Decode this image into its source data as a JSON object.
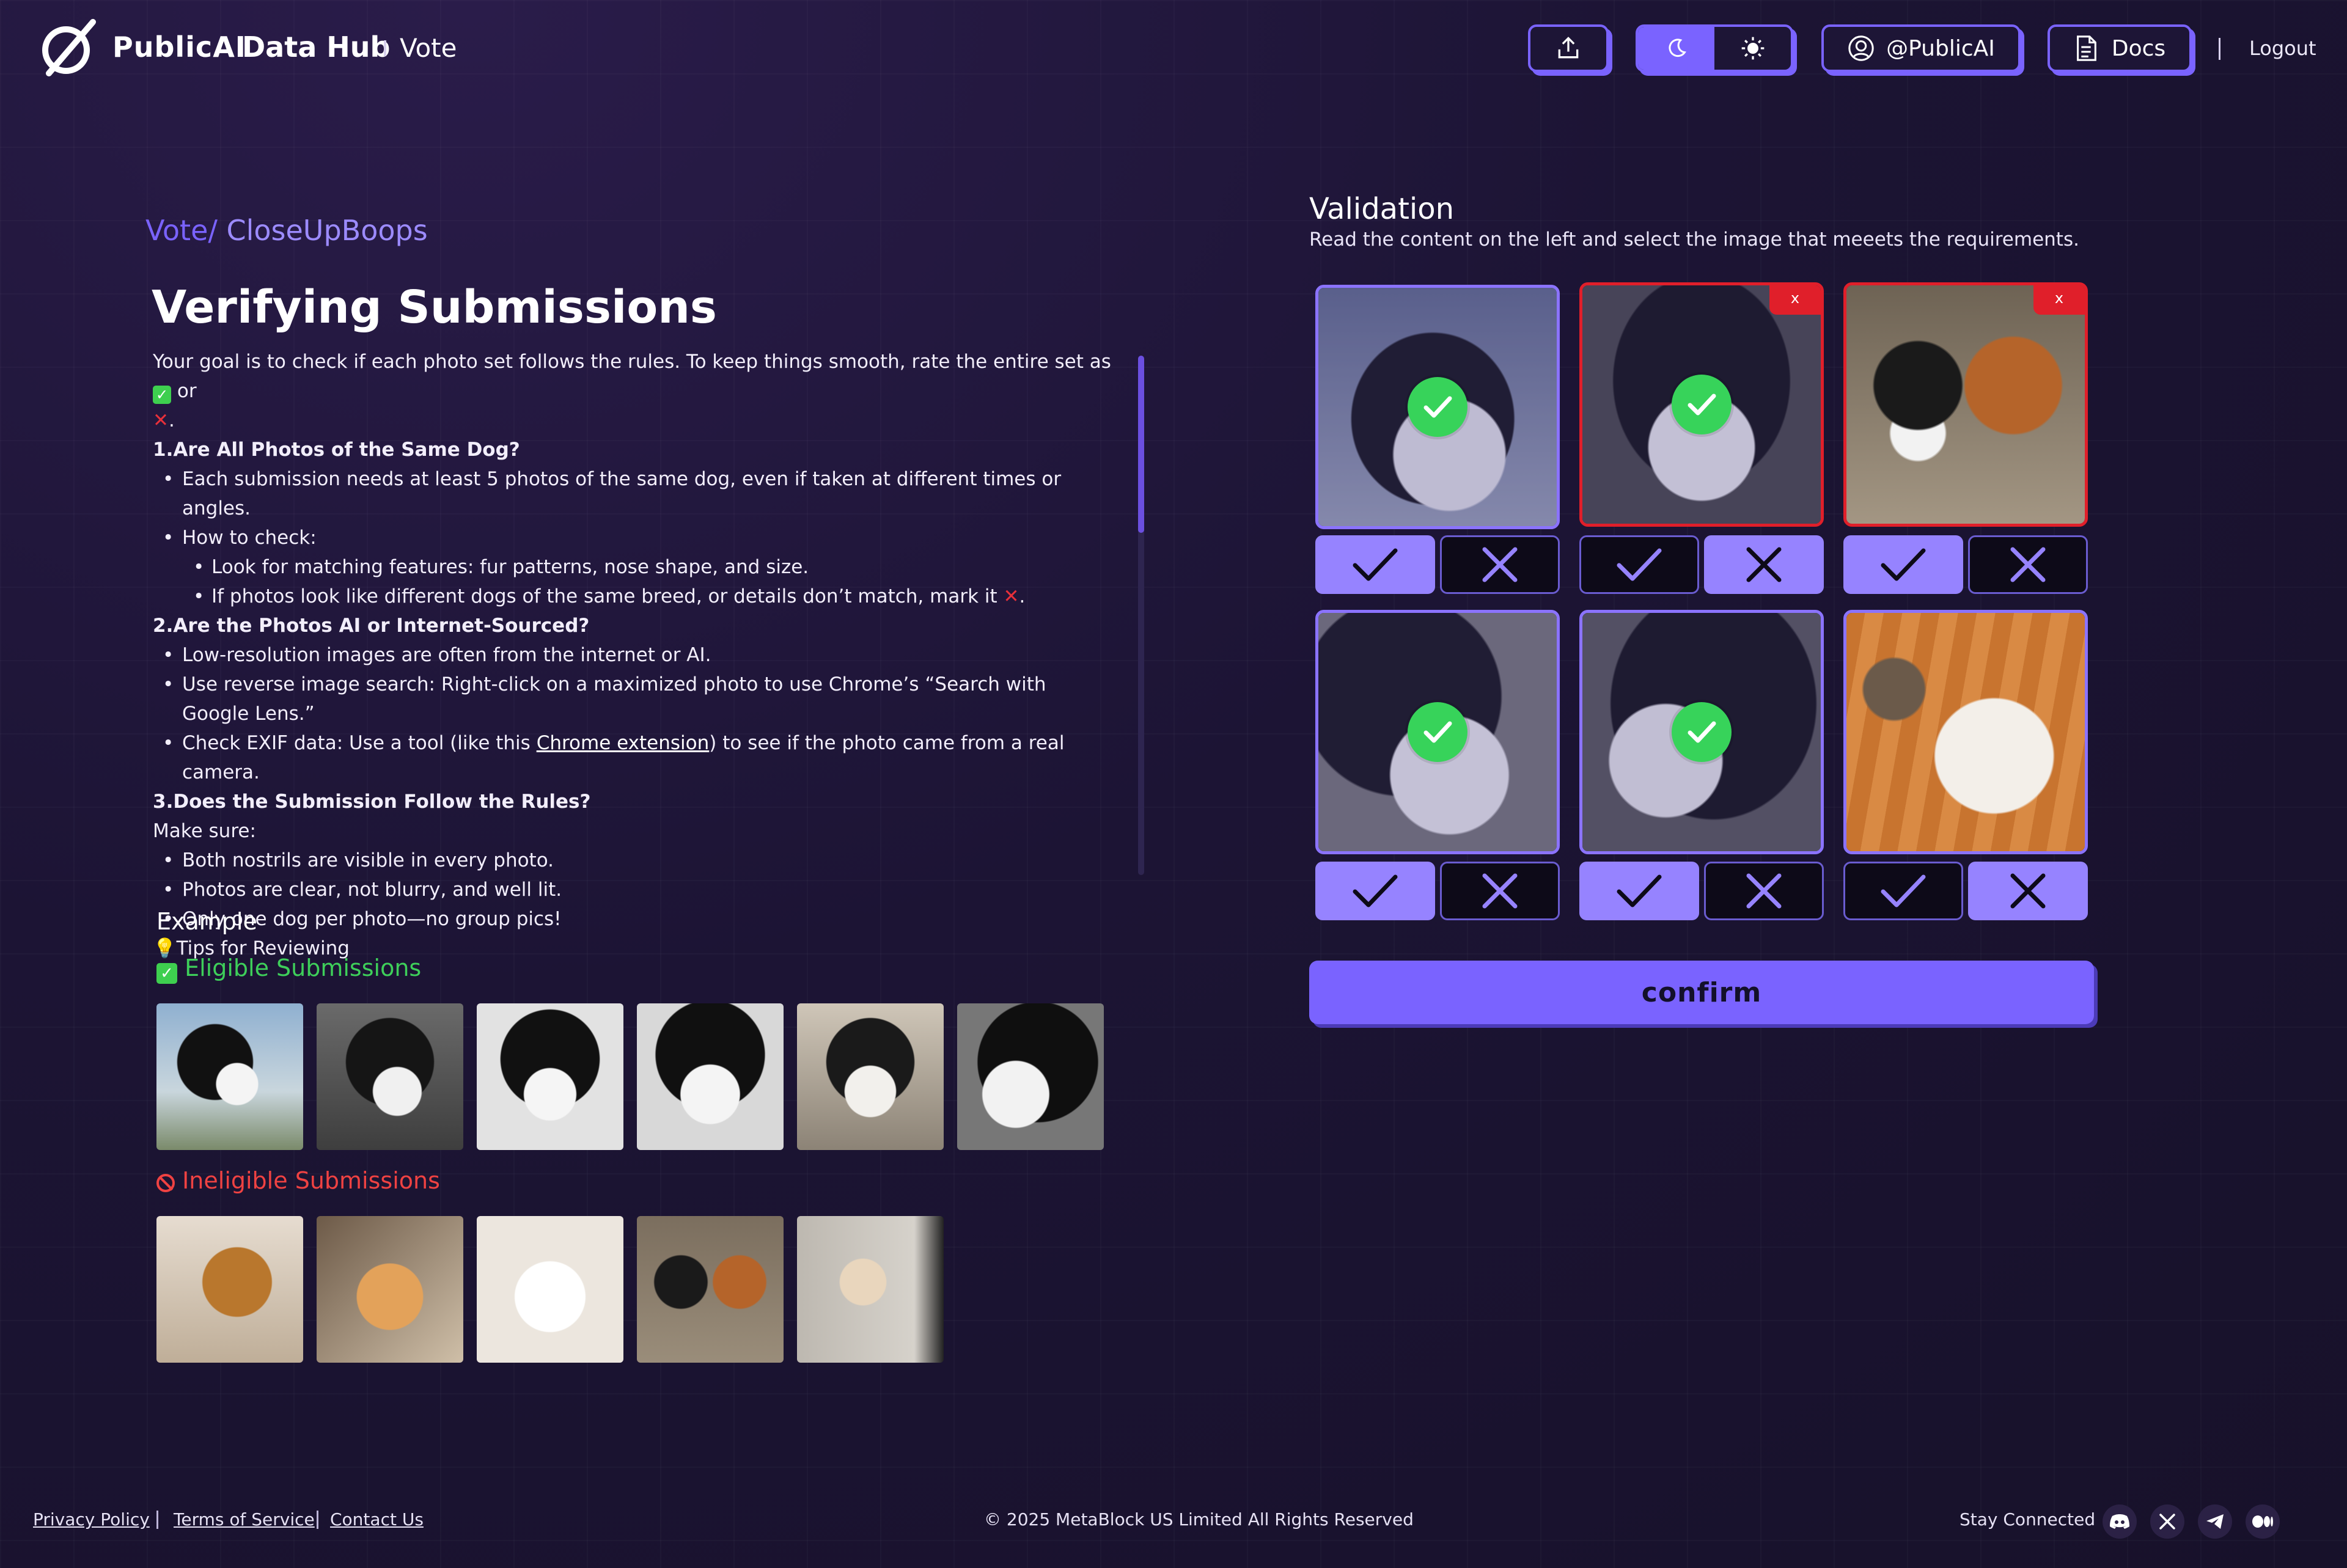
{
  "header": {
    "brand": "PublicAI",
    "brand_sub": "Data Hub",
    "page": "Vote",
    "twitter_label": "@PublicAI",
    "docs_label": "Docs",
    "logout_label": "Logout",
    "theme_active": "dark"
  },
  "breadcrumb": {
    "root": "Vote/",
    "current": "CloseUpBoops"
  },
  "title": "Verifying Submissions",
  "instructions": {
    "intro_a": "Your goal is to check if each photo set follows the rules. To keep things smooth, rate the entire set as",
    "intro_or": "or",
    "s1_title": "1.Are All Photos of the Same Dog?",
    "s1_b1": "Each submission needs at least 5 photos of the same dog, even if taken at different times or angles.",
    "s1_b2": "How to check:",
    "s1_b2a": "Look for matching features: fur patterns, nose shape, and size.",
    "s1_b2b": "If photos look like different dogs of the same breed, or details don’t match, mark it",
    "s2_title": "2.Are the Photos AI or Internet-Sourced?",
    "s2_b1": "Low-resolution images are often from the internet or AI.",
    "s2_b2": "Use reverse image search: Right-click on a maximized photo to use Chrome’s “Search with Google Lens.”",
    "s2_b3a": "Check EXIF data: Use a tool (like this",
    "s2_b3_link": "Chrome extension",
    "s2_b3b": ") to see if the photo came from a real camera.",
    "s3_title": "3.Does the Submission Follow the Rules?",
    "s3_make_sure": "Make sure:",
    "s3_b1": "Both nostrils are visible in every photo.",
    "s3_b2": "Photos are clear, not blurry, and well lit.",
    "s3_b3": "Only one dog per photo—no group pics!",
    "tips": "Tips for Reviewing"
  },
  "example": {
    "title": "Example",
    "eligible_label": "Eligible Submissions",
    "ineligible_label": "Ineligible Submissions"
  },
  "validation": {
    "title": "Validation",
    "description": "Read the content on the left and select the image that meeets the requirements.",
    "reject_tag": "x",
    "confirm_label": "confirm",
    "cards": [
      {
        "name": "border-collie-tongue",
        "status": "selected",
        "vote": "approve"
      },
      {
        "name": "border-collie-closeup",
        "status": "rejected",
        "vote": "reject"
      },
      {
        "name": "two-dogs-group",
        "status": "rejected",
        "vote": "reject"
      },
      {
        "name": "border-collie-nose",
        "status": "selected",
        "vote": "approve"
      },
      {
        "name": "border-collie-side",
        "status": "selected",
        "vote": "approve"
      },
      {
        "name": "dog-with-bowl",
        "status": "none",
        "vote": "reject"
      }
    ]
  },
  "footer": {
    "privacy": "Privacy Policy",
    "terms": "Terms of Service",
    "contact": "Contact Us",
    "copyright": "© 2025 MetaBlock US Limited All Rights Reserved",
    "stay_connected": "Stay Connected",
    "socials": [
      "discord-icon",
      "x-icon",
      "telegram-icon",
      "medium-icon"
    ]
  },
  "colors": {
    "accent": "#7a63ff",
    "approve_green": "#37d35a",
    "reject_red": "#e01f2a",
    "background": "#1c1434"
  }
}
